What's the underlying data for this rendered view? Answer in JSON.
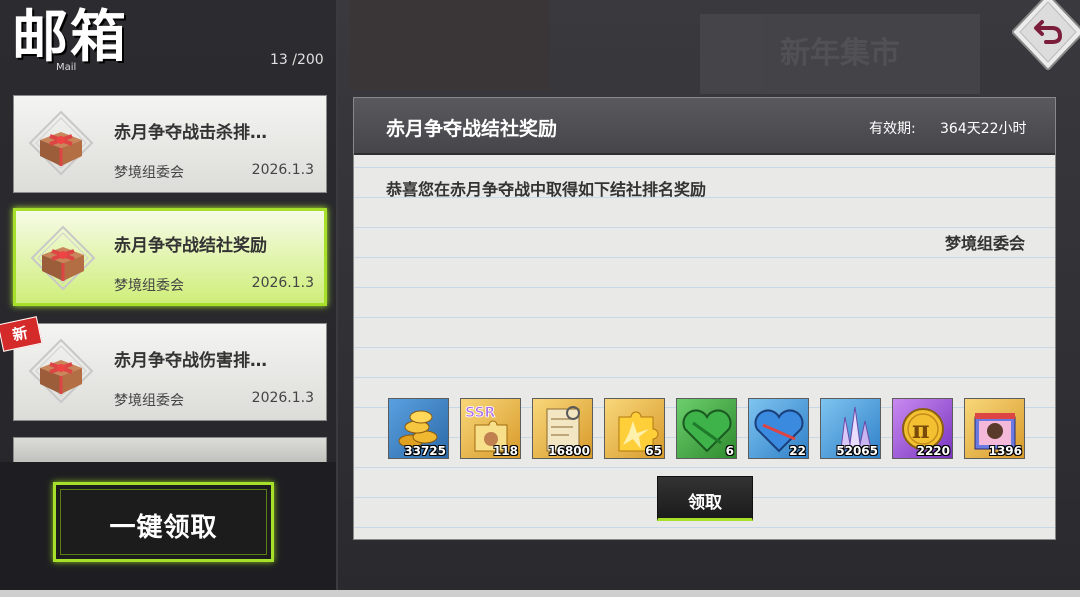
{
  "header": {
    "title": "邮箱",
    "subtitle": "Mail",
    "mail_count": "13 /200"
  },
  "mails": [
    {
      "title": "赤月争夺战击杀排…",
      "sender": "梦境组委会",
      "date": "2026.1.3",
      "selected": false,
      "is_new": false
    },
    {
      "title": "赤月争夺战结社奖励",
      "sender": "梦境组委会",
      "date": "2026.1.3",
      "selected": true,
      "is_new": false
    },
    {
      "title": "赤月争夺战伤害排…",
      "sender": "梦境组委会",
      "date": "2026.1.3",
      "selected": false,
      "is_new": true
    }
  ],
  "new_badge": "新",
  "claim_all_label": "一键领取",
  "background_banner": "新年集市",
  "detail": {
    "title": "赤月争夺战结社奖励",
    "validity_label": "有效期:",
    "validity_value": "364天22小时",
    "body": "恭喜您在赤月争夺战中取得如下结社排名奖励",
    "signature": "梦境组委会",
    "claim_label": "领取"
  },
  "rewards": [
    {
      "icon": "gold-coins-icon",
      "count": "33725",
      "bg": "#3a7fc2"
    },
    {
      "icon": "ssr-puzzle-icon",
      "count": "118",
      "bg": "#e6b23a"
    },
    {
      "icon": "scroll-icon",
      "count": "16800",
      "bg": "#e6b23a"
    },
    {
      "icon": "puzzle-piece-icon",
      "count": "65",
      "bg": "#e6b23a"
    },
    {
      "icon": "green-heart-box-icon",
      "count": "6",
      "bg": "#4caf50"
    },
    {
      "icon": "blue-heart-box-icon",
      "count": "22",
      "bg": "#3a7fc2"
    },
    {
      "icon": "crystal-icon",
      "count": "52065",
      "bg": "#3a7fc2"
    },
    {
      "icon": "pi-coin-icon",
      "count": "2220",
      "bg": "#9b4fd6"
    },
    {
      "icon": "gift-box-icon",
      "count": "1396",
      "bg": "#e6b23a"
    }
  ],
  "colors": {
    "accent": "#a6e02a",
    "new_badge": "#d42a2a"
  }
}
